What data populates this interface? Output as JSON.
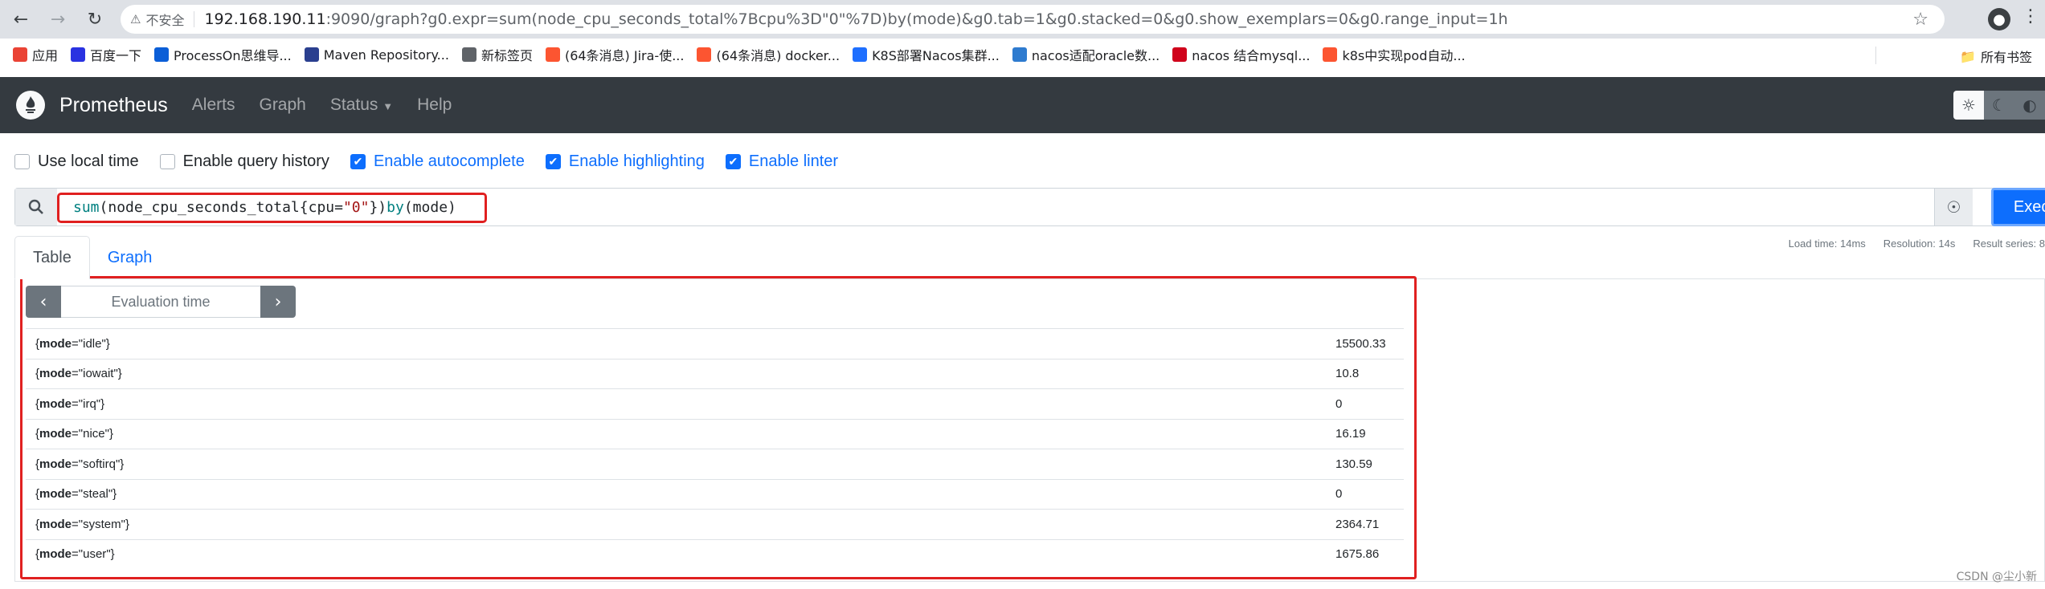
{
  "browser": {
    "security_label": "不安全",
    "url_host": "192.168.190.11",
    "url_rest": ":9090/graph?g0.expr=sum(node_cpu_seconds_total%7Bcpu%3D\"0\"%7D)by(mode)&g0.tab=1&g0.stacked=0&g0.show_exemplars=0&g0.range_input=1h",
    "bookmarks": [
      {
        "label": "应用",
        "color": "#ea4335"
      },
      {
        "label": "百度一下",
        "color": "#2932e1"
      },
      {
        "label": "ProcessOn思维导...",
        "color": "#0b5ed7"
      },
      {
        "label": "Maven Repository...",
        "color": "#2a3f8f"
      },
      {
        "label": "新标签页",
        "color": "#5f6368"
      },
      {
        "label": "(64条消息) Jira-使...",
        "color": "#fc5531"
      },
      {
        "label": "(64条消息) docker...",
        "color": "#fc5531"
      },
      {
        "label": "K8S部署Nacos集群...",
        "color": "#1e6fff"
      },
      {
        "label": "nacos适配oracle数...",
        "color": "#2e7bcf"
      },
      {
        "label": "nacos 结合mysql...",
        "color": "#d0021b"
      },
      {
        "label": "k8s中实现pod自动...",
        "color": "#fc5531"
      }
    ],
    "all_bookmarks": "所有书签"
  },
  "navbar": {
    "brand": "Prometheus",
    "links": [
      "Alerts",
      "Graph",
      "Status",
      "Help"
    ]
  },
  "options": [
    {
      "label": "Use local time",
      "checked": false
    },
    {
      "label": "Enable query history",
      "checked": false
    },
    {
      "label": "Enable autocomplete",
      "checked": true
    },
    {
      "label": "Enable highlighting",
      "checked": true
    },
    {
      "label": "Enable linter",
      "checked": true
    }
  ],
  "query": {
    "fn": "sum",
    "open": "(node_cpu_seconds_total{cpu=",
    "str": "\"0\"",
    "close": "})",
    "by": "by",
    "tail": "(mode)"
  },
  "execute_label": "Execute",
  "tabs": {
    "table": "Table",
    "graph": "Graph"
  },
  "stats": {
    "load_time": "Load time: 14ms",
    "resolution": "Resolution: 14s",
    "result_series": "Result series: 8"
  },
  "eval_time_placeholder": "Evaluation time",
  "results": [
    {
      "key": "mode",
      "mode": "idle",
      "value": "15500.33"
    },
    {
      "key": "mode",
      "mode": "iowait",
      "value": "10.8"
    },
    {
      "key": "mode",
      "mode": "irq",
      "value": "0"
    },
    {
      "key": "mode",
      "mode": "nice",
      "value": "16.19"
    },
    {
      "key": "mode",
      "mode": "softirq",
      "value": "130.59"
    },
    {
      "key": "mode",
      "mode": "steal",
      "value": "0"
    },
    {
      "key": "mode",
      "mode": "system",
      "value": "2364.71"
    },
    {
      "key": "mode",
      "mode": "user",
      "value": "1675.86"
    }
  ],
  "watermark": "CSDN @尘小新"
}
